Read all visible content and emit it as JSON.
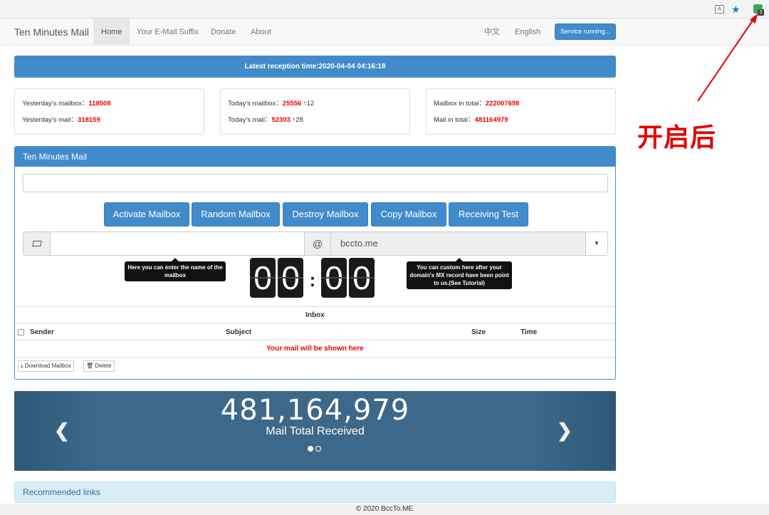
{
  "browser": {
    "ext_badge": "3"
  },
  "nav": {
    "brand": "Ten Minutes Mail",
    "items": [
      "Home",
      "Your E-Mail Suffix",
      "Donate",
      "About"
    ],
    "lang_zh": "中文",
    "lang_en": "English",
    "service_button": "Service running..."
  },
  "latest": "Latest reception time:2020-04-04 04:16:18",
  "stats": {
    "yesterday_mailbox_label": "Yesterday's mailbox：",
    "yesterday_mailbox": "118508",
    "yesterday_mail_label": "Yesterday's mail：",
    "yesterday_mail": "318159",
    "today_mailbox_label": "Today's mailbox：",
    "today_mailbox": "25556",
    "today_mailbox_delta": "↑12",
    "today_mail_label": "Today's mail：",
    "today_mail": "52303",
    "today_mail_delta": "↑28",
    "total_mailbox_label": "Mailbox in total：",
    "total_mailbox": "222007698",
    "total_mail_label": "Mail in total：",
    "total_mail": "481164979"
  },
  "panel": {
    "title": "Ten Minutes Mail",
    "buttons": [
      "Activate Mailbox",
      "Random Mailbox",
      "Destroy Mailbox",
      "Copy Mailbox",
      "Receiving Test"
    ],
    "at": "@",
    "domain": "bccto.me",
    "tooltip_name": "Here you can enter the name of the mailbox",
    "tooltip_domain": "You can custom here after your domain's MX record have been point to us.(See Tutorial)",
    "timer": [
      "0",
      "0",
      "0",
      "0"
    ],
    "timer_sep": ":",
    "inbox_title": "Inbox",
    "columns": {
      "sender": "Sender",
      "subject": "Subject",
      "size": "Size",
      "time": "Time"
    },
    "empty_text": "Your mail will be shown here",
    "download_button": "Download Mailbox",
    "delete_button": "Delete"
  },
  "carousel": {
    "number": "481,164,979",
    "label": "Mail Total Received",
    "prev": "❮",
    "next": "❯"
  },
  "recommended": "Recommended links",
  "footer": "© 2020 BccTo.ME",
  "annotation": "开启后"
}
